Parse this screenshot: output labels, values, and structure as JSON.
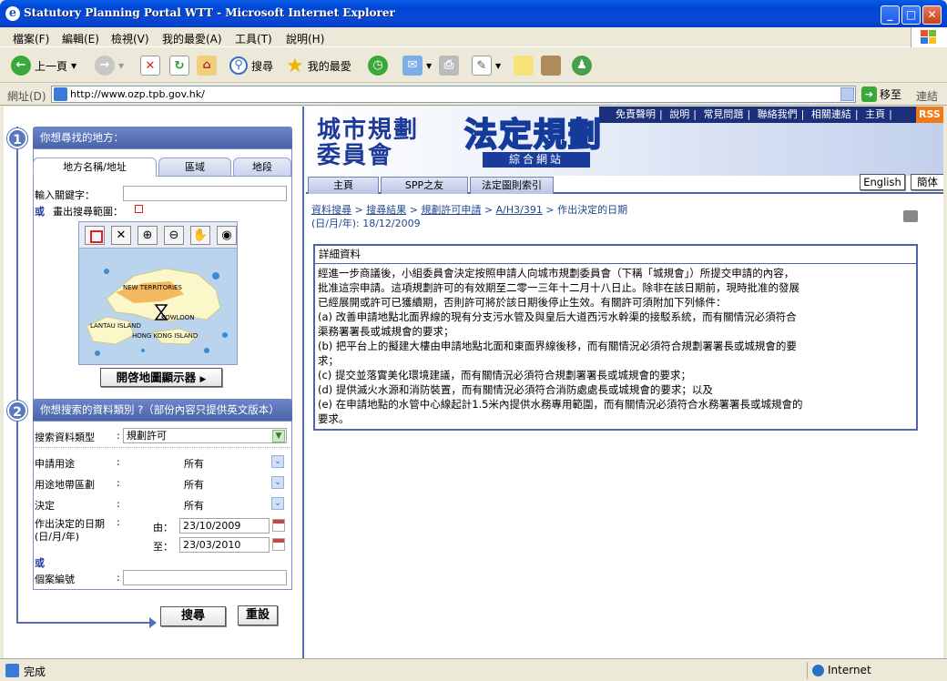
{
  "window": {
    "title": "Statutory Planning Portal WTT - Microsoft Internet Explorer"
  },
  "menu": [
    "檔案(F)",
    "編輯(E)",
    "檢視(V)",
    "我的最愛(A)",
    "工具(T)",
    "說明(H)"
  ],
  "toolbar": {
    "back": "上一頁",
    "search": "搜尋",
    "favorites": "我的最愛"
  },
  "address": {
    "label": "網址(D)",
    "url": "http://www.ozp.tpb.gov.hk/",
    "go": "移至",
    "links": "連結"
  },
  "left": {
    "step1": {
      "num": "1",
      "title": "你想尋找的地方：",
      "tabs": [
        "地方名稱/地址",
        "區域",
        "地段"
      ],
      "keyword_label": "輸入關鍵字：",
      "or_label": "或",
      "draw_label": "畫出搜尋範圍：",
      "map_labels": {
        "nt": "NEW TERRITORIES",
        "kowloon": "KOWLOON",
        "lantau": "LANTAU ISLAND",
        "hk": "HONG KONG ISLAND"
      },
      "open_map_btn": "開啓地圖顯示器"
    },
    "step2": {
      "num": "2",
      "title": "你想搜索的資料類別 ?（部份內容只提供英文版本）",
      "type_label": "搜索資料類型",
      "type_value": "規劃許可",
      "use_label": "申請用途",
      "use_value": "所有",
      "zone_label": "用途地帶區劃",
      "zone_value": "所有",
      "decision_label": "決定",
      "decision_value": "所有",
      "date_label": "作出決定的日期",
      "date_label2": "(日/月/年)",
      "from_label": "由：",
      "from_value": "23/10/2009",
      "to_label": "至：",
      "to_value": "23/03/2010",
      "or_label": "或",
      "case_label": "個案編號",
      "colon": ":"
    },
    "search_btn": "搜尋",
    "reset_btn": "重設"
  },
  "right": {
    "toplinks": [
      "免責聲明",
      "說明",
      "常見問題",
      "聯絡我們",
      "相關連結",
      "主頁"
    ],
    "sep": "|",
    "rss": "RSS",
    "logo_left_1": "城市規劃",
    "logo_left_2": "委員會",
    "logo_main": "法定規劃",
    "logo_sub": "綜合網站",
    "navtabs": [
      "主頁",
      "SPP之友",
      "法定圖則索引"
    ],
    "lang": [
      "English",
      "簡体"
    ],
    "crumb": {
      "c1": "資料搜尋",
      "c2": "搜尋結果",
      "c3": "規劃許可申請",
      "c4": "A/H3/391",
      "c5": "作出決定的日期",
      "arrow": ">",
      "date_line": "(日/月/年): 18/12/2009"
    },
    "detail_title": "詳細資料",
    "detail_body": "經進一步商議後，小組委員會決定按照申請人向城市規劃委員會（下稱「城規會」）所提交申請的內容，\n批准這宗申請。這項規劃許可的有效期至二零一三年十二月十八日止。除非在該日期前，現時批准的發展\n已經展開或許可已獲續期，否則許可將於該日期後停止生效。有關許可須附加下列條件：\n(a) 改善申請地點北面界線的現有分支污水管及與皇后大道西污水幹渠的接駁系統，而有關情況必須符合\n渠務署署長或城規會的要求；\n(b) 把平台上的擬建大樓由申請地點北面和東面界線後移，而有關情況必須符合規劃署署長或城規會的要\n求；\n(c) 提交並落實美化環境建議，而有關情況必須符合規劃署署長或城規會的要求；\n(d) 提供滅火水源和消防裝置，而有關情況必須符合消防處處長或城規會的要求；以及\n(e) 在申請地點的水管中心線起計1.5米內提供水務專用範圍，而有關情況必須符合水務署署長或城規會的\n要求。"
  },
  "status": {
    "text": "完成",
    "zone": "Internet"
  }
}
